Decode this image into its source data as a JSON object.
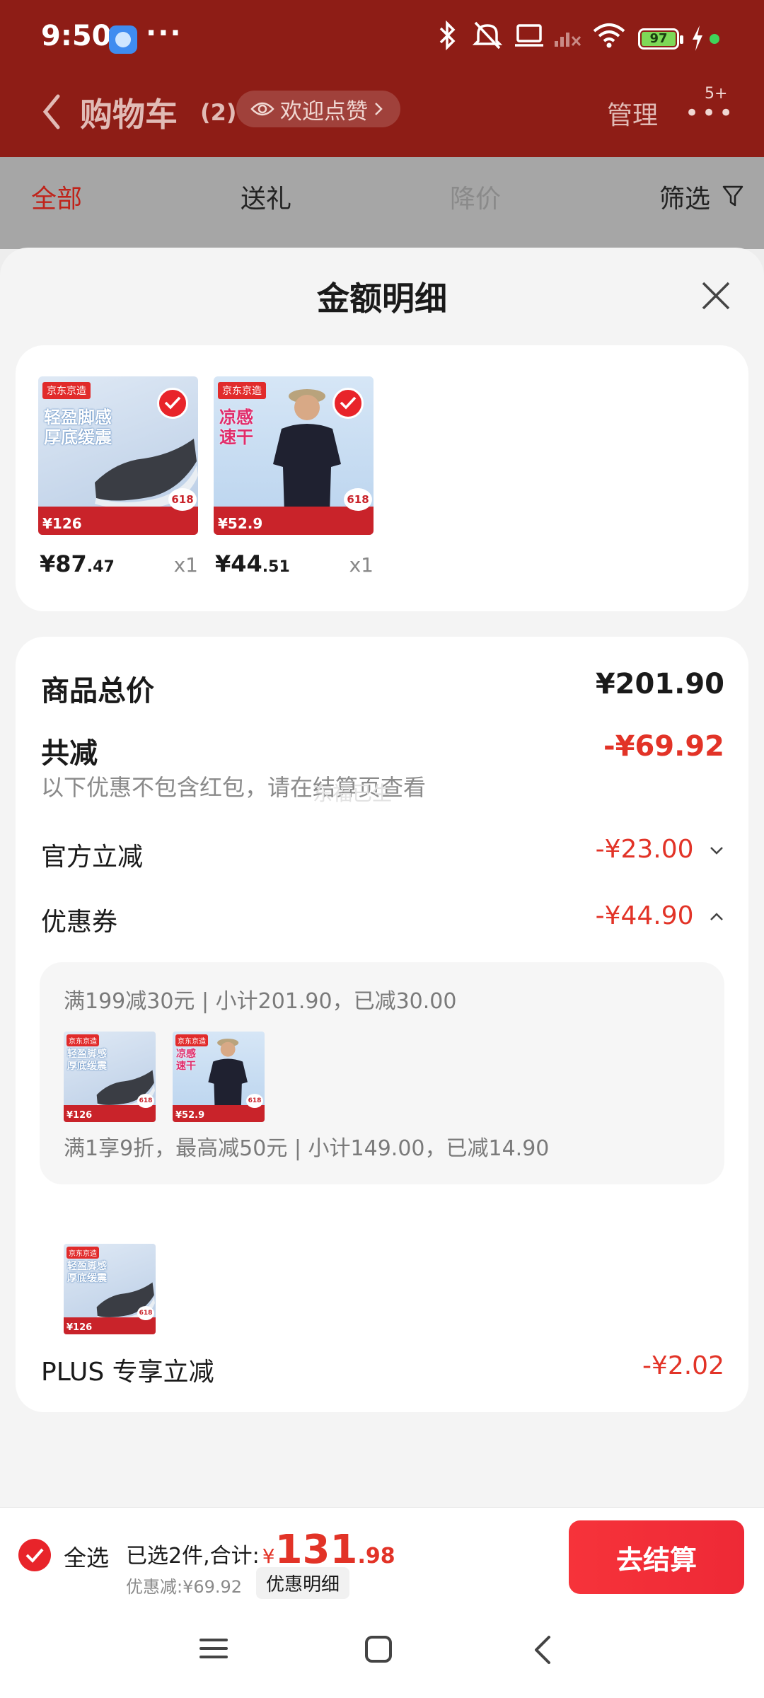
{
  "status_bar": {
    "time": "9:50",
    "more": "···",
    "battery": "97"
  },
  "header": {
    "title": "购物车",
    "count": "(2)",
    "welcome_pill": "欢迎点赞",
    "manage": "管理",
    "msg_badge": "5+"
  },
  "filter_tabs": [
    {
      "label": "全部",
      "state": "active"
    },
    {
      "label": "送礼",
      "state": "normal"
    },
    {
      "label": "降价",
      "state": "dim"
    },
    {
      "label": "筛选",
      "state": "normal"
    }
  ],
  "sheet": {
    "title": "金额明细"
  },
  "products": [
    {
      "jd_tag": "京东京造",
      "img_text": "轻盈脚感\n厚底缓震",
      "img_price": "¥126",
      "badge": "618",
      "price_int": "¥87",
      "price_dec": ".47",
      "qty": "x1"
    },
    {
      "jd_tag": "京东京造",
      "img_text": "凉感\n速干",
      "img_price": "¥52.9",
      "badge": "618",
      "price_int": "¥44",
      "price_dec": ".51",
      "qty": "x1"
    }
  ],
  "details": {
    "total_label": "商品总价",
    "total_value": "¥201.90",
    "reduce_label": "共减",
    "reduce_value": "-¥69.92",
    "note": "以下优惠不包含红包，请在结算页查看",
    "watermark": "东福已生",
    "official_label": "官方立减",
    "official_value": "-¥23.00",
    "coupon_label": "优惠券",
    "coupon_value": "-¥44.90",
    "coupon_rule_1": "满199减30元 | 小计201.90，已减30.00",
    "coupon_rule_2": "满1享9折，最高减50元 | 小计149.00，已减14.90",
    "plus_label": "PLUS 专享立减",
    "plus_value": "-¥2.02"
  },
  "bottom_bar": {
    "select_all": "全选",
    "selected_text": "已选2件,合计:",
    "currency": "¥",
    "total_int": "131",
    "total_dec": ".98",
    "discount_text": "优惠减:¥69.92",
    "detail_button": "优惠明细",
    "checkout": "去结算"
  },
  "colors": {
    "accent_red": "#e23327",
    "header_red": "#8e1d16",
    "checkout_red": "#f6333a"
  },
  "icons": [
    "back-chevron-icon",
    "eye-icon",
    "filter-icon",
    "close-icon",
    "check-icon",
    "chevron-down-icon",
    "chevron-up-icon",
    "menu-icon",
    "home-icon",
    "back-icon",
    "bluetooth-icon",
    "mute-icon",
    "laptop-icon",
    "signal-icon",
    "wifi-icon",
    "battery-icon"
  ]
}
